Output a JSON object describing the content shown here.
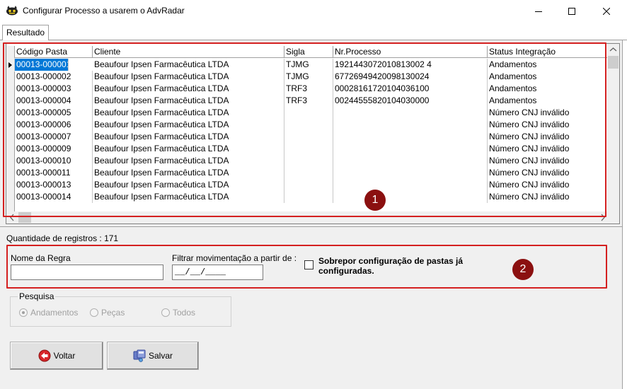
{
  "window": {
    "title": "Configurar Processo a usarem o AdvRadar",
    "icon": "advradar-cat-icon",
    "minimize_icon": "minimize-icon",
    "maximize_icon": "maximize-icon",
    "close_icon": "close-icon"
  },
  "tabs": [
    {
      "label": "Resultado"
    }
  ],
  "grid": {
    "columns": [
      "Código Pasta",
      "Cliente",
      "Sigla",
      "Nr.Processo",
      "Status Integração"
    ],
    "rows": [
      [
        "00013-000001",
        "Beaufour Ipsen Farmacêutica LTDA",
        "TJMG",
        "1921443072010813002 4",
        "Andamentos"
      ],
      [
        "00013-000002",
        "Beaufour Ipsen Farmacêutica LTDA",
        "TJMG",
        "67726949420098130024",
        "Andamentos"
      ],
      [
        "00013-000003",
        "Beaufour Ipsen Farmacêutica LTDA",
        "TRF3",
        "00028161720104036100",
        "Andamentos"
      ],
      [
        "00013-000004",
        "Beaufour Ipsen Farmacêutica LTDA",
        "TRF3",
        "00244555820104030000",
        "Andamentos"
      ],
      [
        "00013-000005",
        "Beaufour Ipsen Farmacêutica LTDA",
        "",
        "",
        "Número CNJ inválido"
      ],
      [
        "00013-000006",
        "Beaufour Ipsen Farmacêutica LTDA",
        "",
        "",
        "Número CNJ inválido"
      ],
      [
        "00013-000007",
        "Beaufour Ipsen Farmacêutica LTDA",
        "",
        "",
        "Número CNJ inválido"
      ],
      [
        "00013-000009",
        "Beaufour Ipsen Farmacêutica LTDA",
        "",
        "",
        "Número CNJ inválido"
      ],
      [
        "00013-000010",
        "Beaufour Ipsen Farmacêutica LTDA",
        "",
        "",
        "Número CNJ inválido"
      ],
      [
        "00013-000011",
        "Beaufour Ipsen Farmacêutica LTDA",
        "",
        "",
        "Número CNJ inválido"
      ],
      [
        "00013-000013",
        "Beaufour Ipsen Farmacêutica LTDA",
        "",
        "",
        "Número CNJ inválido"
      ],
      [
        "00013-000014",
        "Beaufour Ipsen Farmacêutica LTDA",
        "",
        "",
        "Número CNJ inválido"
      ]
    ],
    "selected_row": 0
  },
  "record_count_label": "Quantidade de registros : 171",
  "annotations": {
    "badge1": "1",
    "badge2": "2",
    "highlight_color": "#d42020",
    "badge_color": "#8b1010"
  },
  "form": {
    "rule_name_label": "Nome da Regra",
    "rule_name_value": "",
    "filter_label": "Filtrar movimentação a partir de :",
    "filter_value": "__/__/____",
    "overwrite_label": "Sobrepor configuração de pastas já configuradas.",
    "overwrite_checked": false
  },
  "search_group": {
    "title": "Pesquisa",
    "options": [
      "Andamentos",
      "Peças",
      "Todos"
    ],
    "selected": "Andamentos"
  },
  "buttons": {
    "back_label": "Voltar",
    "back_icon": "back-arrow-icon",
    "save_label": "Salvar",
    "save_icon": "save-icon"
  },
  "colors": {
    "selection": "#0078d7",
    "window_bg": "#f0f0f0"
  }
}
